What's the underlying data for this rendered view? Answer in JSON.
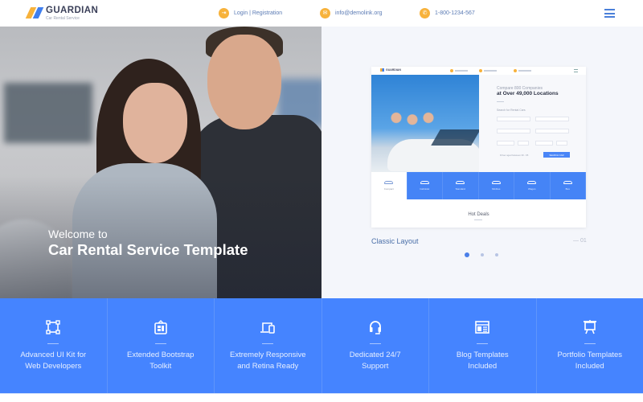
{
  "header": {
    "brand": "GUARDIAN",
    "tagline": "Car Rental Service",
    "links": [
      {
        "icon": "login-icon",
        "glyph": "⇥",
        "label": "Login | Registration"
      },
      {
        "icon": "mail-icon",
        "glyph": "✉",
        "label": "info@demolink.org"
      },
      {
        "icon": "phone-icon",
        "glyph": "✆",
        "label": "1-800-1234-567"
      }
    ],
    "menu_icon": "hamburger-menu-icon"
  },
  "hero": {
    "welcome": "Welcome to",
    "title": "Car Rental Service Template"
  },
  "preview": {
    "mock": {
      "brand": "GUARDIAN",
      "subheading": "Compare 800 Companies",
      "heading": "at Over 49,000 Locations",
      "search_label": "Search for Rental Cars",
      "note": "Driver aged between 30 - 65",
      "search_button": "SEARCH CAR",
      "car_tabs": [
        "Compact",
        "Cabriolet",
        "Standard",
        "Minibus",
        "Wagon",
        "Bus"
      ],
      "active_tab": "Compact",
      "hot_deals": "Hot Deals"
    },
    "label": "Classic Layout",
    "number": "— 01",
    "slides": 3,
    "active_slide": 1
  },
  "features": [
    {
      "icon": "ui-kit-icon",
      "text_line1": "Advanced UI Kit for",
      "text_line2": "Web Developers"
    },
    {
      "icon": "bootstrap-toolkit-icon",
      "text_line1": "Extended Bootstrap",
      "text_line2": "Toolkit"
    },
    {
      "icon": "responsive-devices-icon",
      "text_line1": "Extremely Responsive",
      "text_line2": "and Retina Ready"
    },
    {
      "icon": "headset-support-icon",
      "text_line1": "Dedicated 24/7",
      "text_line2": "Support"
    },
    {
      "icon": "blog-template-icon",
      "text_line1": "Blog Templates",
      "text_line2": "Included"
    },
    {
      "icon": "portfolio-easel-icon",
      "text_line1": "Portfolio Templates",
      "text_line2": "Included"
    }
  ],
  "colors": {
    "accent_blue": "#4584ff",
    "accent_orange": "#f7b23b",
    "link_blue": "#5b7bb4"
  }
}
